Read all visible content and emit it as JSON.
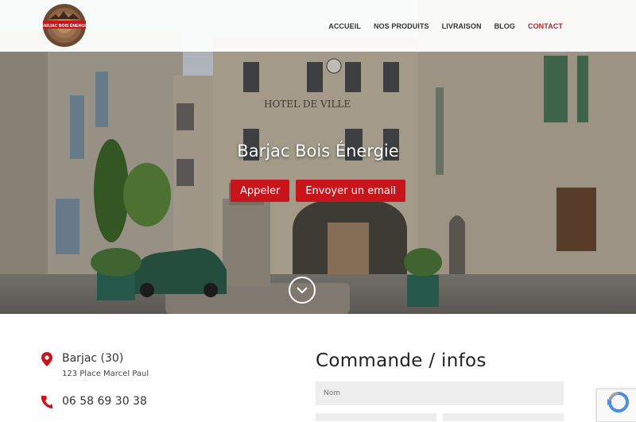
{
  "brand": {
    "logo_text": "BARJAC BOIS ÉNERGIE"
  },
  "nav": {
    "items": [
      {
        "label": "ACCUEIL"
      },
      {
        "label": "NOS PRODUITS"
      },
      {
        "label": "LIVRAISON"
      },
      {
        "label": "BLOG"
      },
      {
        "label": "CONTACT"
      }
    ],
    "active": "CONTACT"
  },
  "hero": {
    "title": "Barjac Bois Énergie",
    "call_button": "Appeler",
    "email_button": "Envoyer un email",
    "building_sign": "HOTEL DE VILLE"
  },
  "contact": {
    "city": "Barjac (30)",
    "address": "123 Place Marcel Paul",
    "phone": "06 58 69 30 38"
  },
  "form": {
    "title": "Commande / infos",
    "name_placeholder": "Nom"
  },
  "colors": {
    "accent": "#c8151b",
    "nav_active": "#b02a2a"
  }
}
